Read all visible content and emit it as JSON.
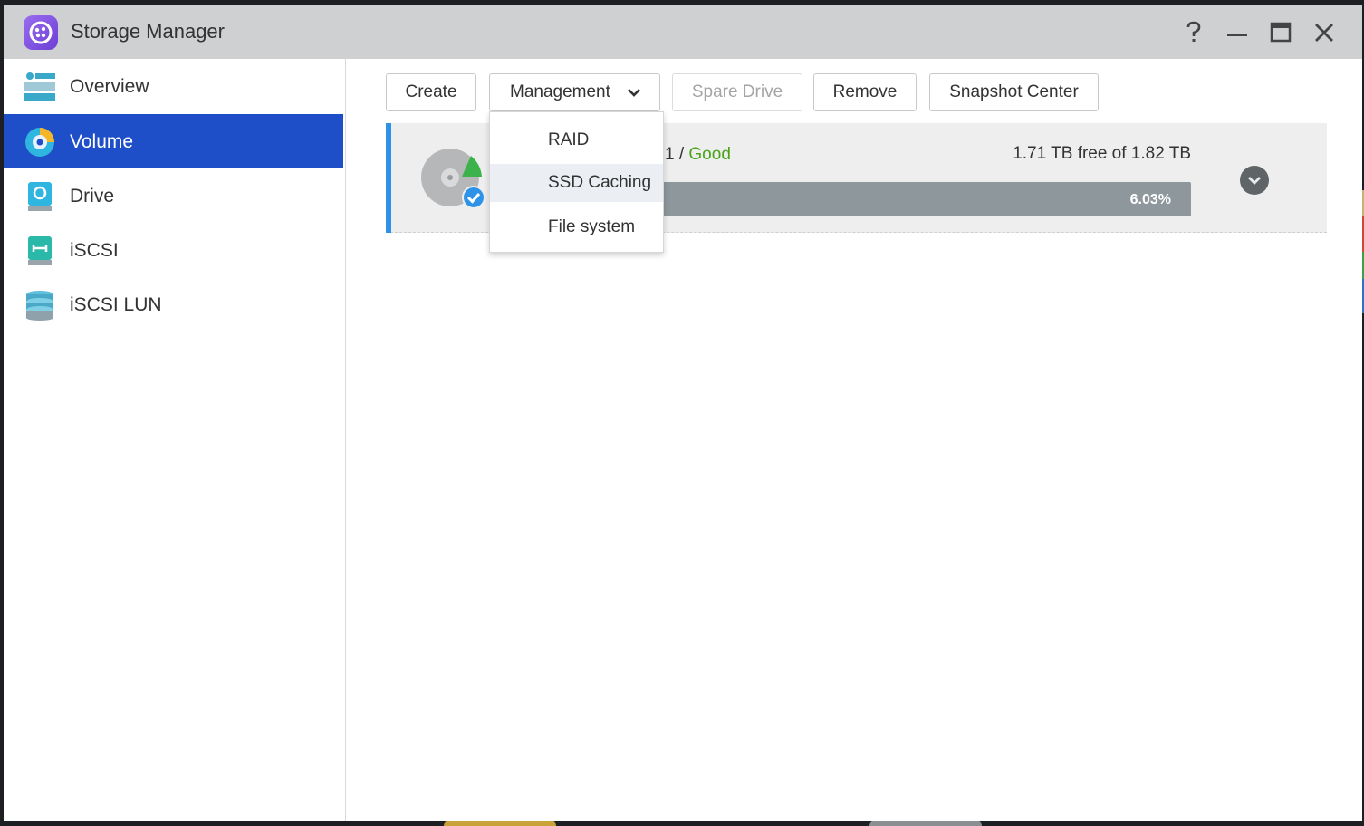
{
  "window": {
    "title": "Storage Manager"
  },
  "window_controls": {
    "help_icon": "question-mark",
    "minimize_icon": "minimize",
    "maximize_icon": "maximize",
    "close_icon": "close"
  },
  "sidebar": {
    "items": [
      {
        "label": "Overview",
        "icon": "overview-icon",
        "active": false
      },
      {
        "label": "Volume",
        "icon": "volume-icon",
        "active": true
      },
      {
        "label": "Drive",
        "icon": "drive-icon",
        "active": false
      },
      {
        "label": "iSCSI",
        "icon": "iscsi-icon",
        "active": false
      },
      {
        "label": "iSCSI LUN",
        "icon": "iscsi-lun-icon",
        "active": false
      }
    ]
  },
  "toolbar": {
    "create": "Create",
    "management": "Management",
    "spare_drive": "Spare Drive",
    "remove": "Remove",
    "snapshot_center": "Snapshot Center"
  },
  "management_menu": {
    "items": [
      "RAID",
      "SSD Caching",
      "File system"
    ],
    "hovered": "SSD Caching"
  },
  "volume": {
    "name_suffix": "1 /",
    "status": "Good",
    "capacity": "1.71 TB free of 1.82 TB",
    "usage_label": "6.03%",
    "usage_fraction": 0.0603
  },
  "colors": {
    "accent_active": "#1f4fc8",
    "status_good": "#4aa31a",
    "row_accent": "#2e93e8"
  }
}
